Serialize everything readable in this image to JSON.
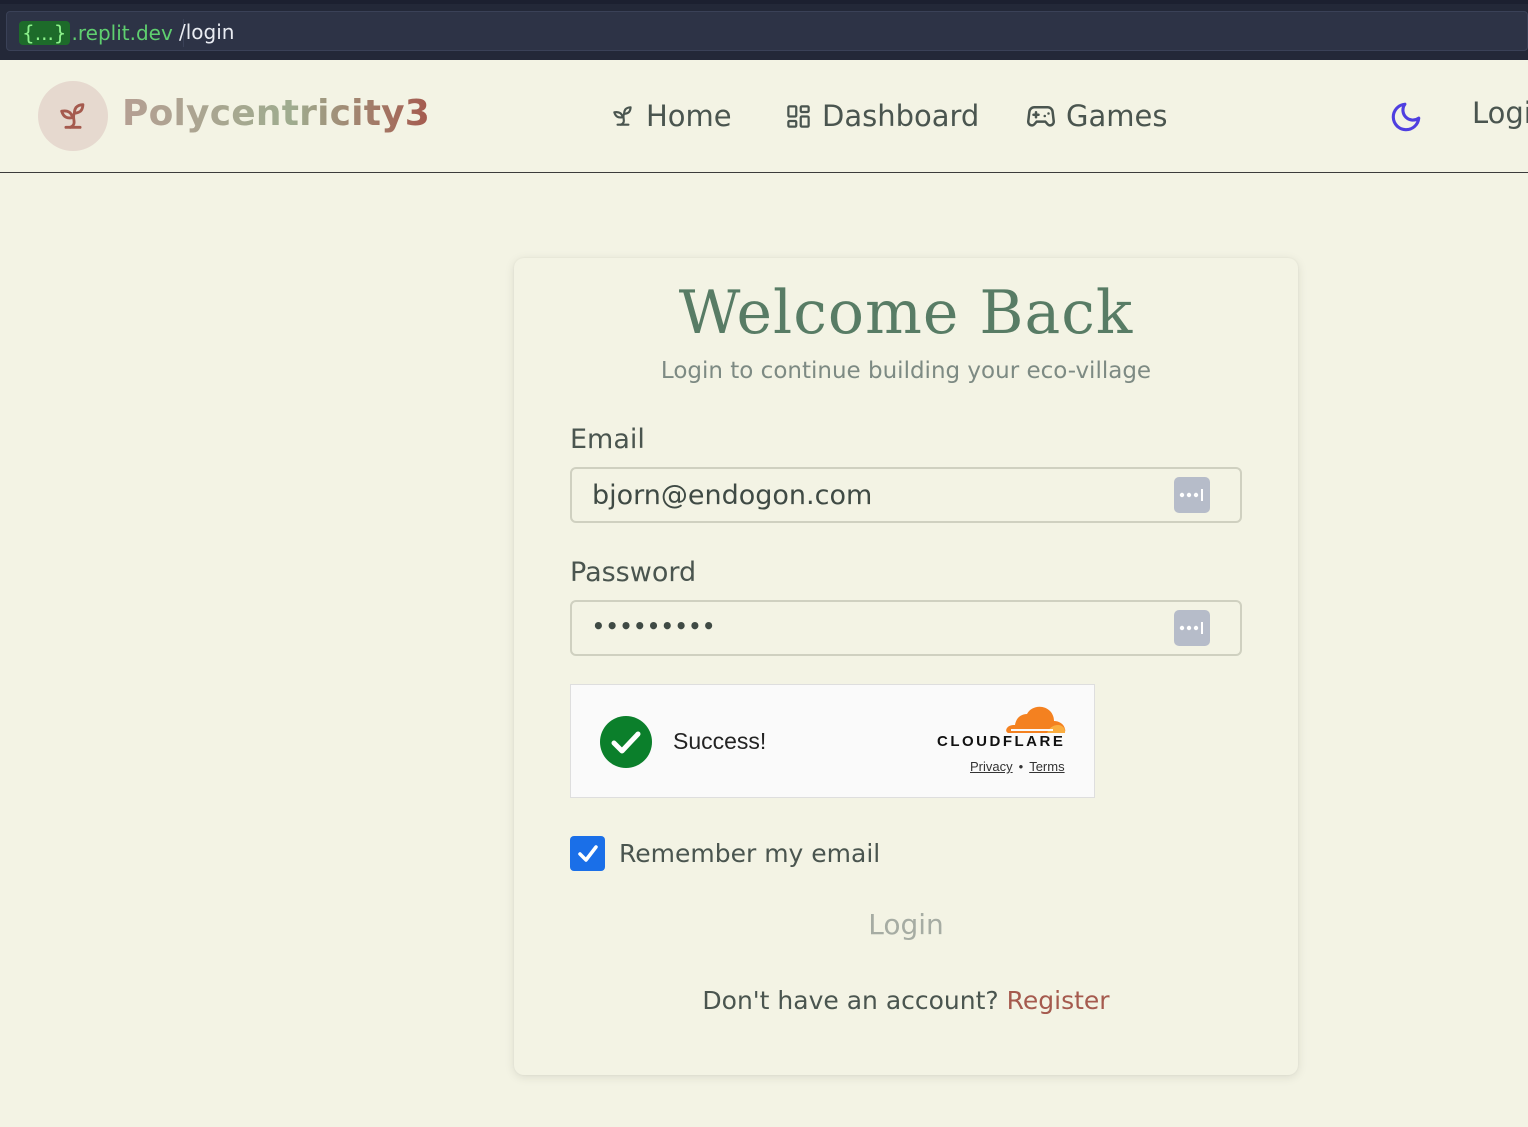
{
  "browser": {
    "domain_prefix": "{...}",
    "domain_suffix": ".replit.dev",
    "path": "/login"
  },
  "nav": {
    "brand": "Polycentricity3",
    "items": [
      {
        "label": "Home",
        "icon": "sprout-icon"
      },
      {
        "label": "Dashboard",
        "icon": "dashboard-grid-icon"
      },
      {
        "label": "Games",
        "icon": "gamepad-icon"
      }
    ],
    "theme_icon": "moon-icon",
    "login_label": "Login"
  },
  "login_card": {
    "title": "Welcome Back",
    "subtitle": "Login to continue building your eco-village",
    "email_label": "Email",
    "email_value": "bjorn@endogon.com",
    "password_label": "Password",
    "password_masked": "•••••••••",
    "captcha": {
      "status": "Success!",
      "provider": "CLOUDFLARE",
      "privacy": "Privacy",
      "separator": "•",
      "terms": "Terms"
    },
    "remember_label": "Remember my email",
    "remember_checked": true,
    "login_button": "Login",
    "register_prompt": "Don't have an account?",
    "register_link": "Register"
  },
  "colors": {
    "background": "#f3f3e4",
    "title_green": "#587c65",
    "accent_red": "#a55a4e",
    "checkbox_blue": "#1a6fe8",
    "success_green": "#0b7f2b",
    "cloudflare_orange": "#f48120"
  }
}
